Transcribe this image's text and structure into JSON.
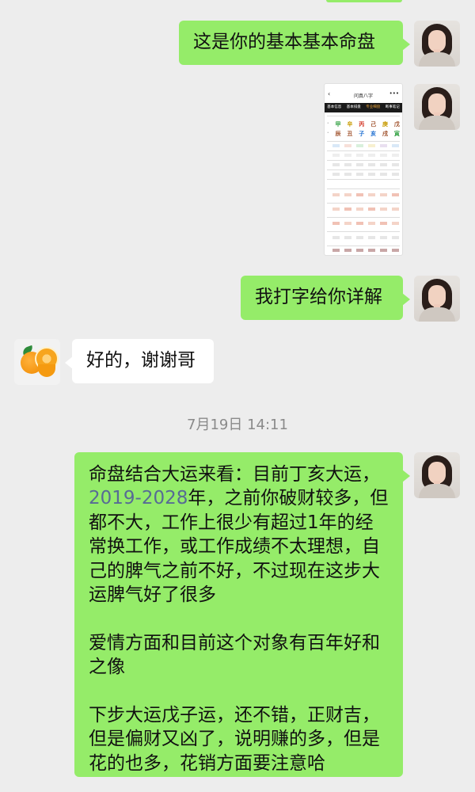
{
  "messages": {
    "m1": {
      "text": "这是你的基本基本命盘"
    },
    "m2": {
      "screenshot": {
        "title": "问真八字",
        "tabs": [
          "基本信息",
          "基本排盘",
          "专业细盘",
          "断事笔记"
        ],
        "stems": [
          "甲",
          "辛",
          "丙",
          "己",
          "庚",
          "戊"
        ],
        "branches": [
          "辰",
          "丑",
          "子",
          "亥",
          "戌",
          "寅"
        ]
      }
    },
    "m3": {
      "text": "我打字给你详解"
    },
    "m4": {
      "text": "好的，谢谢哥"
    },
    "timestamp": "7月19日 14:11",
    "m5": {
      "before_year": "命盘结合大运来看：目前丁亥大运，",
      "year": "2019-2028",
      "after_year": "年，之前你破财较多，但都不大，工作上很少有超过1年的经常换工作，或工作成绩不太理想，自己的脾气之前不好，不过现在这步大运脾气好了很多\n\n爱情方面和目前这个对象有百年好和之像\n\n下步大运戊子运，还不错，正财吉，但是偏财又凶了，说明赚的多，但是花的也多，花销方面要注意哈"
    }
  },
  "icons": {
    "self_avatar": "woman-portrait-avatar",
    "contact_avatar": "oranges-avatar"
  },
  "colors": {
    "background": "#ededed",
    "sent_bubble": "#95ec69",
    "received_bubble": "#ffffff",
    "year_link": "#576b95"
  }
}
